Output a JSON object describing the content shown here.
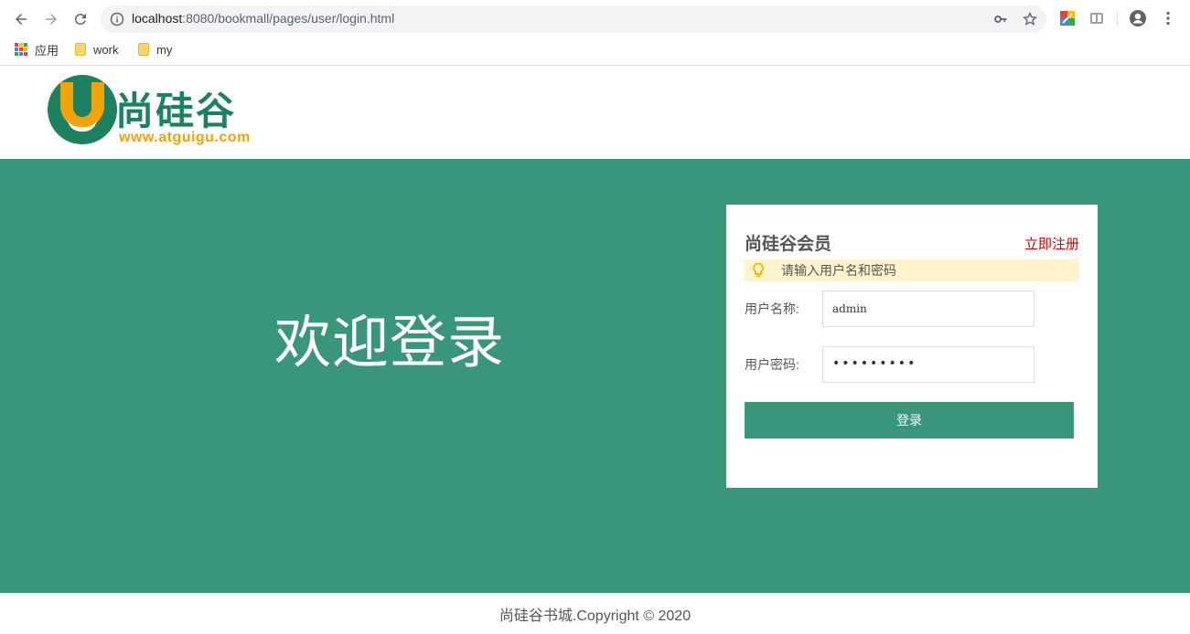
{
  "browser": {
    "url_host": "localhost",
    "url_rest": ":8080/bookmall/pages/user/login.html",
    "bookmarks": [
      {
        "label": "应用"
      },
      {
        "label": "work"
      },
      {
        "label": "my"
      }
    ]
  },
  "header": {
    "logo_text": "尚硅谷",
    "logo_url": "www.atguigu.com"
  },
  "main": {
    "welcome_text": "欢迎登录"
  },
  "login": {
    "title": "尚硅谷会员",
    "register_link": "立即注册",
    "tip": "请输入用户名和密码",
    "username_label": "用户名称:",
    "username_value": "admin",
    "password_label": "用户密码:",
    "password_value": "•••••••••",
    "submit_label": "登录"
  },
  "footer": {
    "copyright": "尚硅谷书城.Copyright © 2020"
  },
  "colors": {
    "brand_green": "#3a967a",
    "logo_green": "#1d8060",
    "logo_orange": "#f0a30a",
    "link_red": "#cc0000",
    "tip_bg": "#fff4cc"
  }
}
